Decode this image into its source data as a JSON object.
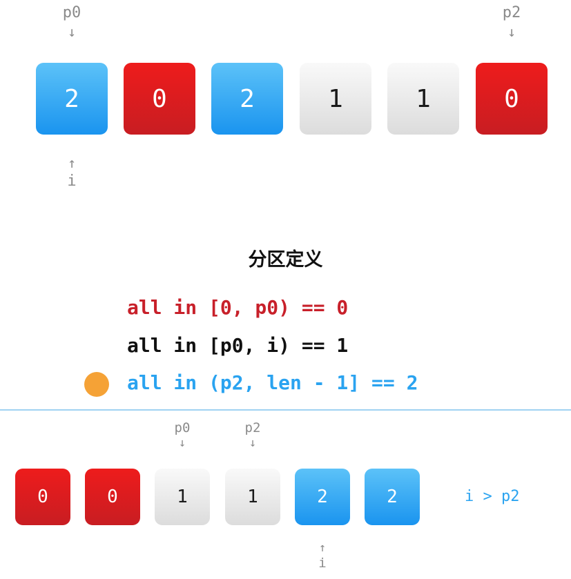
{
  "top": {
    "cells": [
      {
        "value": "2",
        "color": "blue"
      },
      {
        "value": "0",
        "color": "red"
      },
      {
        "value": "2",
        "color": "blue"
      },
      {
        "value": "1",
        "color": "gray"
      },
      {
        "value": "1",
        "color": "gray"
      },
      {
        "value": "0",
        "color": "red"
      }
    ],
    "p0": {
      "label": "p0",
      "arrow": "↓"
    },
    "p2": {
      "label": "p2",
      "arrow": "↓"
    },
    "i": {
      "label": "i",
      "arrow": "↑"
    }
  },
  "title": "分区定义",
  "rules": [
    {
      "text": "all in [0, p0) == 0",
      "color": "#c8202a"
    },
    {
      "text": "all in [p0, i) == 1",
      "color": "#111111"
    },
    {
      "text": "all in (p2, len - 1] == 2",
      "color": "#2aa3f0"
    }
  ],
  "colors": {
    "red": "#e01f22",
    "blue": "#2aa3f0",
    "gray": "#e6e6e6",
    "dot": "#f5a236",
    "divider": "#9fd2f2"
  },
  "bottom": {
    "cells": [
      {
        "value": "0",
        "color": "red"
      },
      {
        "value": "0",
        "color": "red"
      },
      {
        "value": "1",
        "color": "gray"
      },
      {
        "value": "1",
        "color": "gray"
      },
      {
        "value": "2",
        "color": "blue"
      },
      {
        "value": "2",
        "color": "blue"
      }
    ],
    "p0": {
      "label": "p0",
      "arrow": "↓"
    },
    "p2": {
      "label": "p2",
      "arrow": "↓"
    },
    "i": {
      "label": "i",
      "arrow": "↑"
    },
    "condition": "i > p2"
  }
}
